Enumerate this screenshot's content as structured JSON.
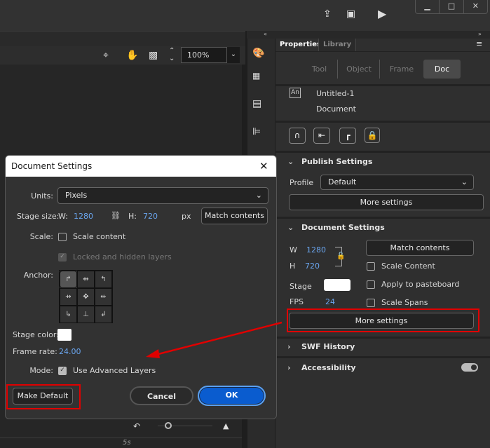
{
  "toolbar": {
    "zoom_value": "100%"
  },
  "panel": {
    "tabs": [
      "Properties",
      "Library"
    ],
    "segments": [
      "Tool",
      "Object",
      "Frame",
      "Doc"
    ],
    "doc_name": "Untitled-1",
    "doc_type": "Document",
    "doc_icon": "An",
    "publish": {
      "title": "Publish Settings",
      "profile_label": "Profile",
      "profile_value": "Default",
      "more_settings": "More settings"
    },
    "docset": {
      "title": "Document Settings",
      "w_label": "W",
      "w_value": "1280",
      "h_label": "H",
      "h_value": "720",
      "match_contents": "Match contents",
      "scale_content": "Scale Content",
      "apply_pasteboard": "Apply to pasteboard",
      "scale_spans": "Scale Spans",
      "stage_label": "Stage",
      "fps_label": "FPS",
      "fps_value": "24",
      "more_settings": "More settings"
    },
    "swf_history": "SWF History",
    "accessibility": "Accessibility",
    "accessibility_on": true
  },
  "dialog": {
    "title": "Document Settings",
    "units_label": "Units:",
    "units_value": "Pixels",
    "stage_size_label": "Stage size:",
    "w_label": "W:",
    "w_value": "1280",
    "h_label": "H:",
    "h_value": "720",
    "unit_px": "px",
    "match_contents": "Match contents",
    "scale_label": "Scale:",
    "scale_content": "Scale content",
    "locked_hidden": "Locked and hidden layers",
    "anchor_label": "Anchor:",
    "stage_color_label": "Stage color:",
    "stage_color": "#ffffff",
    "frame_rate_label": "Frame rate:",
    "frame_rate_value": "24.00",
    "mode_label": "Mode:",
    "mode_value": "Use Advanced Layers",
    "make_default": "Make Default",
    "cancel": "Cancel",
    "ok": "OK"
  },
  "timeline": {
    "marker": "5s"
  },
  "colors": {
    "accent": "#0a5ccf",
    "highlight": "#e00000",
    "value": "#6aa5ee"
  }
}
